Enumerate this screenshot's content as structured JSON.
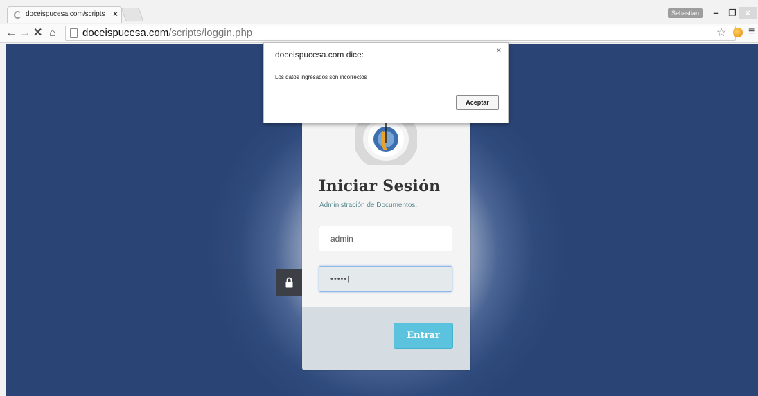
{
  "browser": {
    "tab_title": "doceispucesa.com/scripts",
    "tab_close": "×",
    "user_name": "Sebastian",
    "window_controls": {
      "minimize": "–",
      "maximize": "❐",
      "close": "×"
    },
    "nav": {
      "back": "←",
      "forward": "→",
      "stop": "✕",
      "home": "⌂"
    },
    "url_host": "doceispucesa.com",
    "url_path": "/scripts/loggin.php",
    "icons": [
      "loading-spinner-icon",
      "page-icon",
      "star-icon",
      "cookie-extension-icon",
      "menu-icon",
      "lock-icon"
    ]
  },
  "login": {
    "title": "Iniciar Sesión",
    "subtitle": "Administración de Documentos.",
    "username_value": "admin",
    "password_value": "•••••|",
    "submit_label": "Entrar"
  },
  "dialog": {
    "title": "doceispucesa.com dice:",
    "close": "×",
    "message": "Los datos ingresados son incorrectos",
    "ok_label": "Aceptar"
  },
  "colors": {
    "page_background": "#2f4a7c",
    "submit_button": "#5bc3de",
    "card_footer": "#d6dde2",
    "lock_tab": "#3c3f45"
  }
}
